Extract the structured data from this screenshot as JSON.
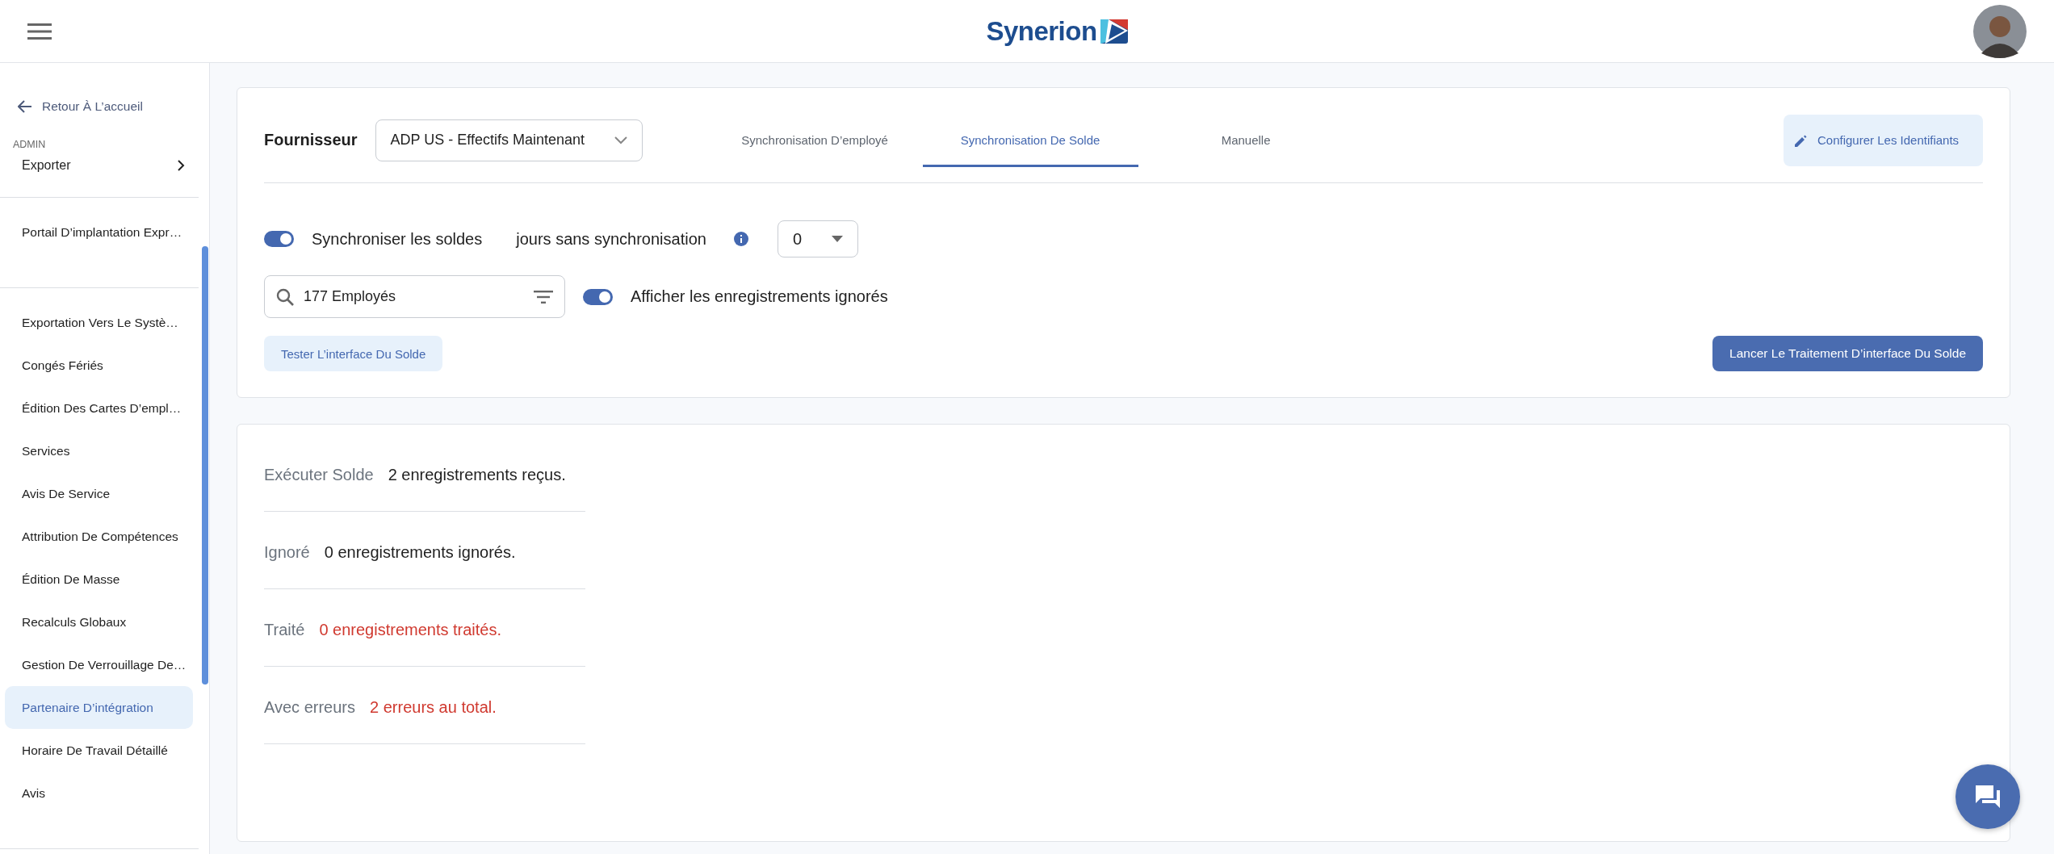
{
  "header": {
    "logo_text": "Synerion"
  },
  "sidebar": {
    "back_link": "Retour À L’accueil",
    "section_label": "ADMIN",
    "expandable": {
      "label": "Exporter",
      "expanded": false
    },
    "groups": [
      [
        {
          "label": "Portail D’implantation Expr…",
          "selected": false
        }
      ],
      [
        {
          "label": "Exportation Vers Le Systè…",
          "selected": false
        },
        {
          "label": "Congés Fériés",
          "selected": false
        },
        {
          "label": "Édition Des Cartes D’empl…",
          "selected": false
        },
        {
          "label": "Services",
          "selected": false
        },
        {
          "label": "Avis De Service",
          "selected": false
        },
        {
          "label": "Attribution De Compétences",
          "selected": false
        },
        {
          "label": "Édition De Masse",
          "selected": false
        },
        {
          "label": "Recalculs Globaux",
          "selected": false
        },
        {
          "label": "Gestion De Verrouillage De…",
          "selected": false
        },
        {
          "label": "Partenaire D’intégration",
          "selected": true
        },
        {
          "label": "Horaire De Travail Détaillé",
          "selected": false
        },
        {
          "label": "Avis",
          "selected": false
        }
      ]
    ]
  },
  "settings": {
    "provider_label": "Fournisseur",
    "provider_value": "ADP US - Effectifs Maintenant",
    "tabs": [
      {
        "label": "Synchronisation D’employé",
        "selected": false
      },
      {
        "label": "Synchronisation De Solde",
        "selected": true
      },
      {
        "label": "Manuelle",
        "selected": false
      }
    ],
    "configure_button": "Configurer Les Identifiants",
    "sync_toggle": {
      "label": "Synchroniser les soldes",
      "on": true
    },
    "days_label": "jours sans synchronisation",
    "days_value": "0",
    "search": {
      "value": "177 Employés"
    },
    "ignored_toggle": {
      "label": "Afficher les enregistrements ignorés",
      "on": true
    },
    "test_button": "Tester L’interface Du Solde",
    "run_button": "Lancer Le Traitement D’interface Du Solde"
  },
  "summary": [
    {
      "label": "Exécuter Solde",
      "value": "2 enregistrements reçus.",
      "error": false
    },
    {
      "label": "Ignoré",
      "value": "0 enregistrements ignorés.",
      "error": false
    },
    {
      "label": "Traité",
      "value": "0 enregistrements traités.",
      "error": true
    },
    {
      "label": "Avec erreurs",
      "value": "2 erreurs au total.",
      "error": true
    }
  ]
}
